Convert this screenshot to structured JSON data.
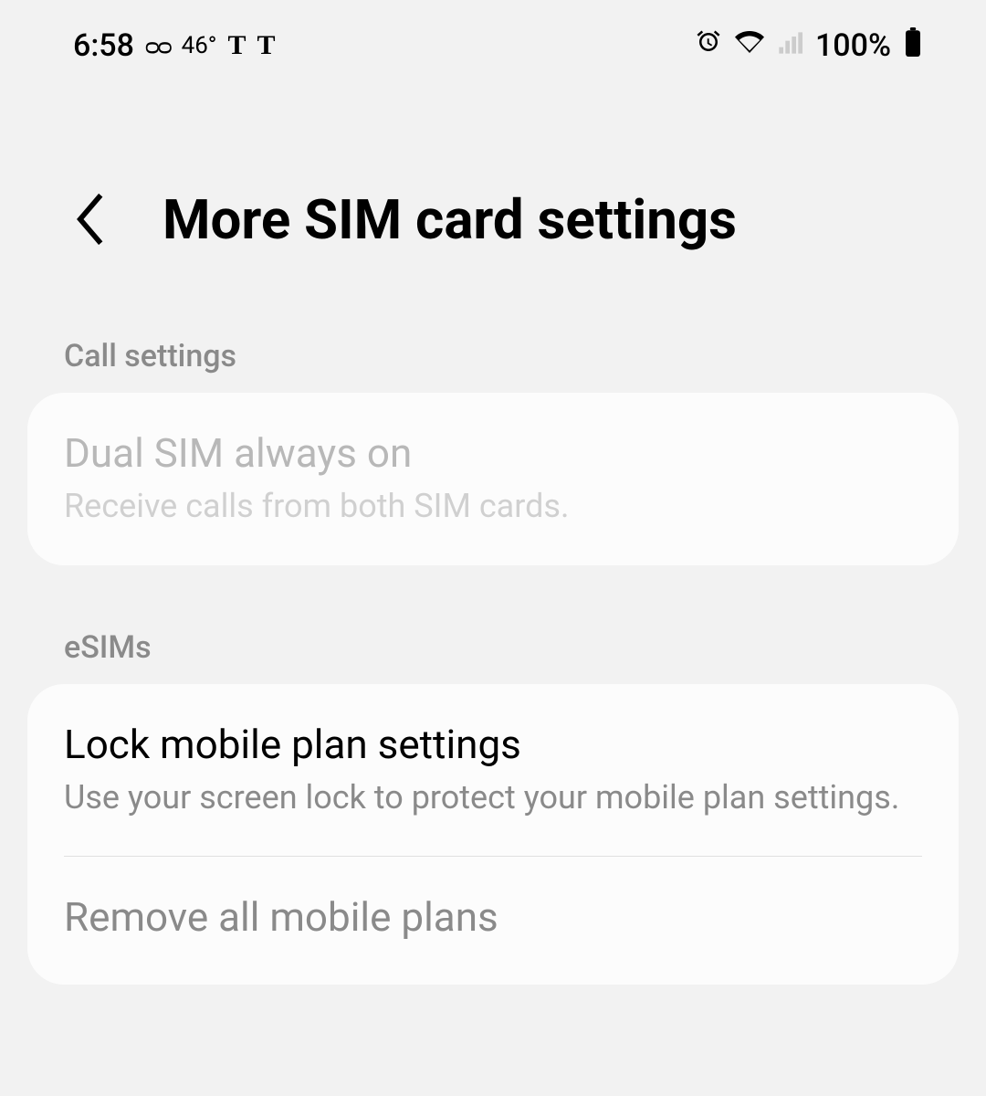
{
  "statusBar": {
    "time": "6:58",
    "voicemail": "ᴑᴑ",
    "temperature": "46°",
    "carrier1": "T",
    "carrier2": "T",
    "batteryPercent": "100%"
  },
  "header": {
    "title": "More SIM card settings"
  },
  "sections": {
    "callSettings": {
      "header": "Call settings",
      "items": {
        "dualSim": {
          "title": "Dual SIM always on",
          "subtitle": "Receive calls from both SIM cards."
        }
      }
    },
    "esims": {
      "header": "eSIMs",
      "items": {
        "lockPlan": {
          "title": "Lock mobile plan settings",
          "subtitle": "Use your screen lock to protect your mobile plan settings."
        },
        "removePlans": {
          "title": "Remove all mobile plans"
        }
      }
    }
  }
}
